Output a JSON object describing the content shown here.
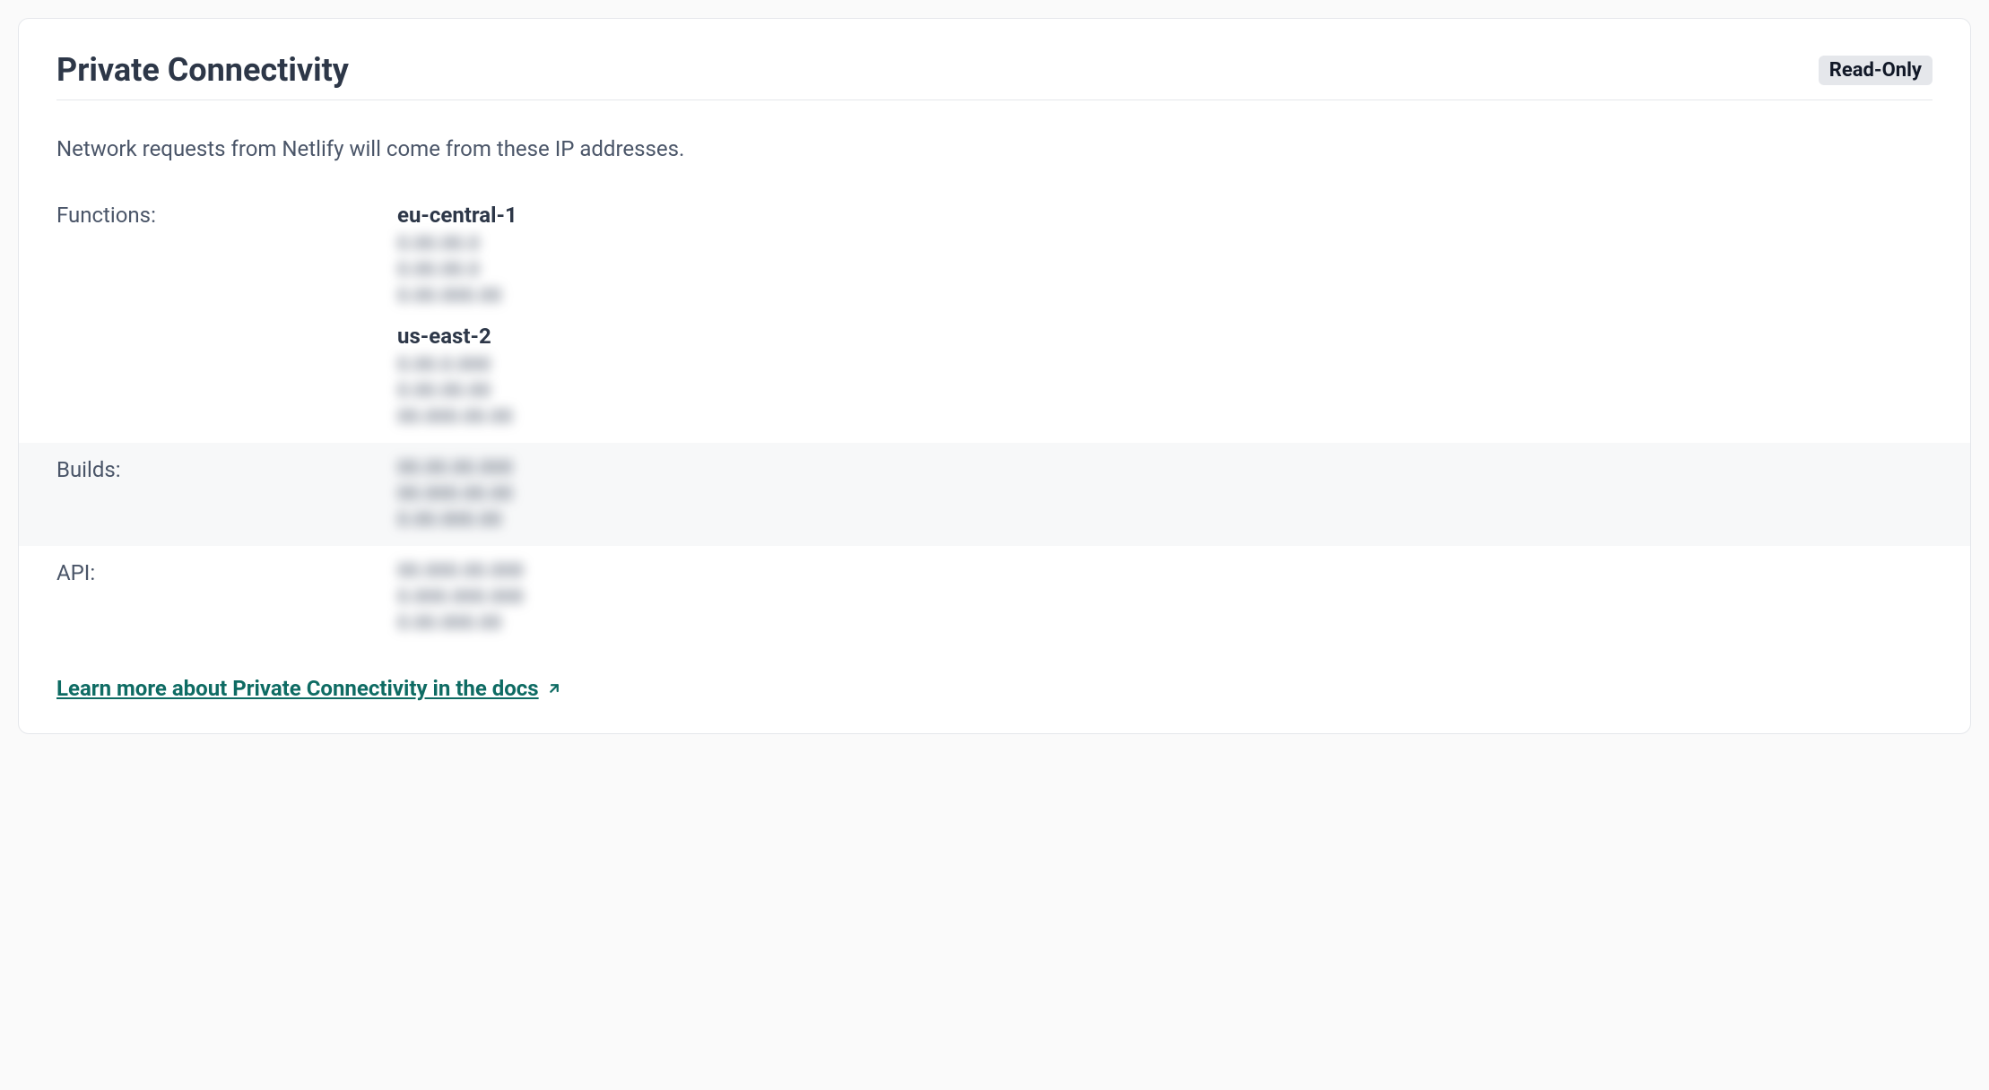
{
  "header": {
    "title": "Private Connectivity",
    "badge": "Read-Only"
  },
  "description": "Network requests from Netlify will come from these IP addresses.",
  "sections": {
    "functions": {
      "label": "Functions:",
      "regions": [
        {
          "name": "eu-central-1",
          "ips": [
            "0.00.00.0",
            "0.00.00.0",
            "0.00.000.00"
          ]
        },
        {
          "name": "us-east-2",
          "ips": [
            "0.00.0.000",
            "0.00.00.00",
            "00.000.00.00"
          ]
        }
      ]
    },
    "builds": {
      "label": "Builds:",
      "ips": [
        "00.00.00.000",
        "00.000.00.00",
        "0.00.000.00"
      ]
    },
    "api": {
      "label": "API:",
      "ips": [
        "00.000.00.000",
        "0.000.000.000",
        "0.00.000.00"
      ]
    }
  },
  "docs_link": "Learn more about Private Connectivity in the docs"
}
